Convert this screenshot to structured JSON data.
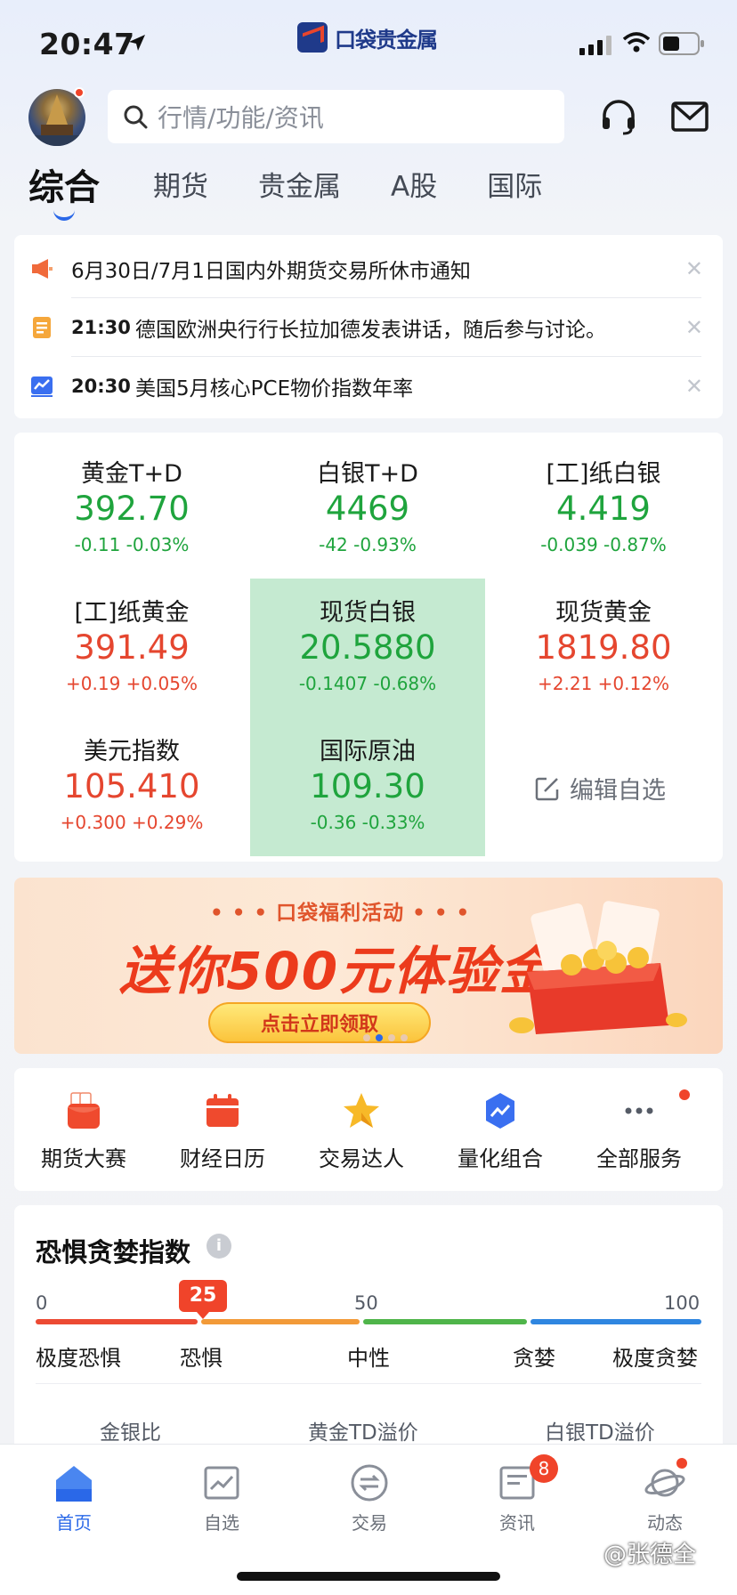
{
  "status_bar": {
    "time": "20:47",
    "app_name": "口袋贵金属"
  },
  "search": {
    "placeholder": "行情/功能/资讯"
  },
  "tabs": [
    {
      "label": "综合",
      "active": true
    },
    {
      "label": "期货"
    },
    {
      "label": "贵金属"
    },
    {
      "label": "A股"
    },
    {
      "label": "国际"
    }
  ],
  "notices": [
    {
      "time": "",
      "text": "6月30日/7月1日国内外期货交易所休市通知",
      "icon": "megaphone-icon"
    },
    {
      "time": "21:30",
      "text": "德国欧洲央行行长拉加德发表讲话，随后参与讨论。",
      "icon": "document-icon"
    },
    {
      "time": "20:30",
      "text": "美国5月核心PCE物价指数年率",
      "icon": "chart-icon"
    }
  ],
  "quotes": [
    {
      "name": "黄金T+D",
      "price": "392.70",
      "change": "-0.11  -0.03%",
      "dir": "down",
      "highlight": false
    },
    {
      "name": "白银T+D",
      "price": "4469",
      "change": "-42  -0.93%",
      "dir": "down",
      "highlight": false
    },
    {
      "name": "[工]纸白银",
      "price": "4.419",
      "change": "-0.039  -0.87%",
      "dir": "down",
      "highlight": false
    },
    {
      "name": "[工]纸黄金",
      "price": "391.49",
      "change": "+0.19  +0.05%",
      "dir": "up",
      "highlight": false
    },
    {
      "name": "现货白银",
      "price": "20.5880",
      "change": "-0.1407  -0.68%",
      "dir": "down",
      "highlight": true
    },
    {
      "name": "现货黄金",
      "price": "1819.80",
      "change": "+2.21  +0.12%",
      "dir": "up",
      "highlight": false
    },
    {
      "name": "美元指数",
      "price": "105.410",
      "change": "+0.300  +0.29%",
      "dir": "up",
      "highlight": false
    },
    {
      "name": "国际原油",
      "price": "109.30",
      "change": "-0.36  -0.33%",
      "dir": "down",
      "highlight": true
    }
  ],
  "edit_favorites": "编辑自选",
  "banner": {
    "subtitle": "• • • 口袋福利活动 • • •",
    "title": "送你500元体验金",
    "button": "点击立即领取"
  },
  "shortcuts": [
    {
      "label": "期货大赛",
      "icon": "red-envelope-icon"
    },
    {
      "label": "财经日历",
      "icon": "calendar-icon"
    },
    {
      "label": "交易达人",
      "icon": "star-icon"
    },
    {
      "label": "量化组合",
      "icon": "trend-badge-icon"
    },
    {
      "label": "全部服务",
      "icon": "more-icon"
    }
  ],
  "fear_greed": {
    "title": "恐惧贪婪指数",
    "value": "25",
    "ticks": [
      "0",
      "50",
      "100"
    ],
    "labels": [
      "极度恐惧",
      "恐惧",
      "中性",
      "贪婪",
      "极度贪婪"
    ],
    "sub_items": [
      "金银比",
      "黄金TD溢价",
      "白银TD溢价"
    ]
  },
  "nav": [
    {
      "label": "首页",
      "active": true
    },
    {
      "label": "自选"
    },
    {
      "label": "交易"
    },
    {
      "label": "资讯",
      "badge": "8"
    },
    {
      "label": "动态"
    }
  ],
  "watermark": "@张德全",
  "colors": {
    "up": "#e5462f",
    "down": "#1fa43d",
    "accent": "#2a68e8",
    "highlight_bg": "#c5ead1"
  }
}
